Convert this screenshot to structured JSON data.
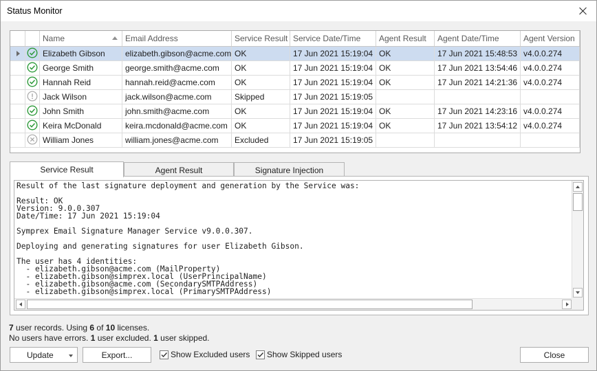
{
  "window": {
    "title": "Status Monitor"
  },
  "grid": {
    "columns": [
      "Name",
      "Email Address",
      "Service Result",
      "Service Date/Time",
      "Agent Result",
      "Agent Date/Time",
      "Agent Version"
    ],
    "rows": [
      {
        "status": "ok",
        "name": "Elizabeth Gibson",
        "email": "elizabeth.gibson@acme.com",
        "service_result": "OK",
        "service_datetime": "17 Jun 2021 15:19:04",
        "agent_result": "OK",
        "agent_datetime": "17 Jun 2021 15:48:53",
        "agent_version": "v4.0.0.274",
        "selected": true
      },
      {
        "status": "ok",
        "name": "George Smith",
        "email": "george.smith@acme.com",
        "service_result": "OK",
        "service_datetime": "17 Jun 2021 15:19:04",
        "agent_result": "OK",
        "agent_datetime": "17 Jun 2021 13:54:46",
        "agent_version": "v4.0.0.274"
      },
      {
        "status": "ok",
        "name": "Hannah Reid",
        "email": "hannah.reid@acme.com",
        "service_result": "OK",
        "service_datetime": "17 Jun 2021 15:19:04",
        "agent_result": "OK",
        "agent_datetime": "17 Jun 2021 14:21:36",
        "agent_version": "v4.0.0.274"
      },
      {
        "status": "skipped",
        "name": "Jack Wilson",
        "email": "jack.wilson@acme.com",
        "service_result": "Skipped",
        "service_datetime": "17 Jun 2021 15:19:05",
        "agent_result": "",
        "agent_datetime": "",
        "agent_version": ""
      },
      {
        "status": "ok",
        "name": "John Smith",
        "email": "john.smith@acme.com",
        "service_result": "OK",
        "service_datetime": "17 Jun 2021 15:19:04",
        "agent_result": "OK",
        "agent_datetime": "17 Jun 2021 14:23:16",
        "agent_version": "v4.0.0.274"
      },
      {
        "status": "ok",
        "name": "Keira McDonald",
        "email": "keira.mcdonald@acme.com",
        "service_result": "OK",
        "service_datetime": "17 Jun 2021 15:19:04",
        "agent_result": "OK",
        "agent_datetime": "17 Jun 2021 13:54:12",
        "agent_version": "v4.0.0.274"
      },
      {
        "status": "excluded",
        "name": "William Jones",
        "email": "william.jones@acme.com",
        "service_result": "Excluded",
        "service_datetime": "17 Jun 2021 15:19:05",
        "agent_result": "",
        "agent_datetime": "",
        "agent_version": ""
      }
    ]
  },
  "tabs": [
    "Service Result",
    "Agent Result",
    "Signature Injection"
  ],
  "result_text": [
    "Result of the last signature deployment and generation by the Service was:",
    "",
    "Result: OK",
    "Version: 9.0.0.307",
    "Date/Time: 17 Jun 2021 15:19:04",
    "",
    "Symprex Email Signature Manager Service v9.0.0.307.",
    "",
    "Deploying and generating signatures for user Elizabeth Gibson.",
    "",
    "The user has 4 identities:",
    "  - elizabeth.gibson@acme.com (MailProperty)",
    "  - elizabeth.gibson@simprex.local (UserPrincipalName)",
    "  - elizabeth.gibson@acme.com (SecondarySMTPAddress)",
    "  - elizabeth.gibson@simprex.local (PrimarySMTPAddress)"
  ],
  "status": {
    "line1": {
      "count": "7",
      "t1": " user records. Using ",
      "used": "6",
      "t2": " of ",
      "total": "10",
      "t3": " licenses."
    },
    "line2": {
      "t1": "No users have errors. ",
      "excluded": "1",
      "t2": " user excluded. ",
      "skipped": "1",
      "t3": " user skipped."
    }
  },
  "buttons": {
    "update": "Update",
    "export": "Export...",
    "close": "Close"
  },
  "checkboxes": {
    "show_excluded": "Show Excluded users",
    "show_skipped": "Show Skipped users"
  },
  "colors": {
    "ok": "#2e9a3a",
    "neutral": "#a8a8a8",
    "selected_row": "#cddcf0"
  }
}
